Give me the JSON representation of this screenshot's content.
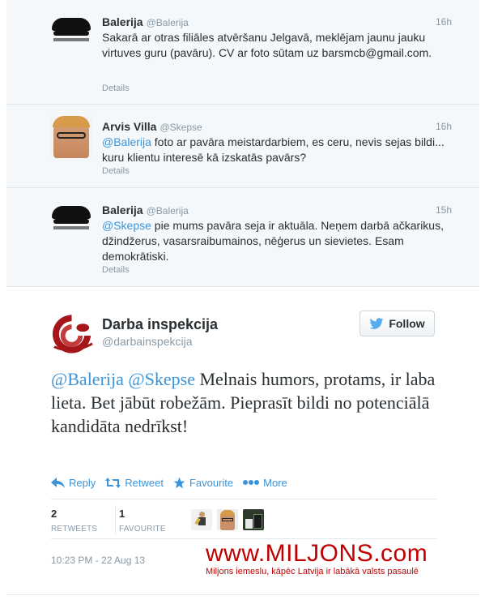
{
  "replies": [
    {
      "name": "Balerija",
      "screen_name": "@Balerija",
      "time": "16h",
      "text_parts": [
        "Sakarā ar otras filiāles atvēršanu Jelgavā, meklējam jaunu jauku virtuves guru (pavāru). CV ar foto sūtam uz barsmcb@gmail.com."
      ],
      "details": "Details",
      "avatar_icon": "black-hat-logo-icon"
    },
    {
      "name": "Arvis Villa",
      "screen_name": "@Skepse",
      "time": "16h",
      "mention": "@Balerija",
      "text": " foto ar pavāra meistardarbiem, es ceru, nevis sejas bildi... kuru klientu interesē kā izskatās pavārs?",
      "details": "Details",
      "avatar_icon": "user-photo-icon"
    },
    {
      "name": "Balerija",
      "screen_name": "@Balerija",
      "time": "15h",
      "mention": "@Skepse",
      "text": " pie mums pavāra seja ir aktuāla. Neņem darbā ačkarikus, džindžerus, vasarsraibumainos, nēģerus un sievietes. Esam demokrātiski.",
      "details": "Details",
      "avatar_icon": "black-hat-logo-icon"
    }
  ],
  "main": {
    "name": "Darba inspekcija",
    "screen_name": "@darbainspekcija",
    "follow_label": "Follow",
    "mention1": "@Balerija",
    "mention2": "@Skepse",
    "text": " Melnais humors, protams, ir laba lieta. Bet jābūt robežām. Pieprasīt bildi no potenciālā kandidāta nedrīkst!",
    "actions": {
      "reply": "Reply",
      "retweet": "Retweet",
      "favourite": "Favourite",
      "more": "More"
    },
    "stats": {
      "retweets_count": "2",
      "retweets_label": "RETWEETS",
      "favourites_count": "1",
      "favourites_label": "FAVOURITE"
    },
    "timestamp": "10:23 PM - 22 Aug 13"
  },
  "watermark": {
    "url": "www.MILJONS.com",
    "tagline": "Miljons iemeslu, kāpēc Latvija ir labākā valsts pasaulē"
  },
  "colors": {
    "link": "#3b94d9",
    "text": "#292f33",
    "muted": "#8899a6",
    "watermark": "#c00000",
    "logo_red": "#a4161a"
  }
}
